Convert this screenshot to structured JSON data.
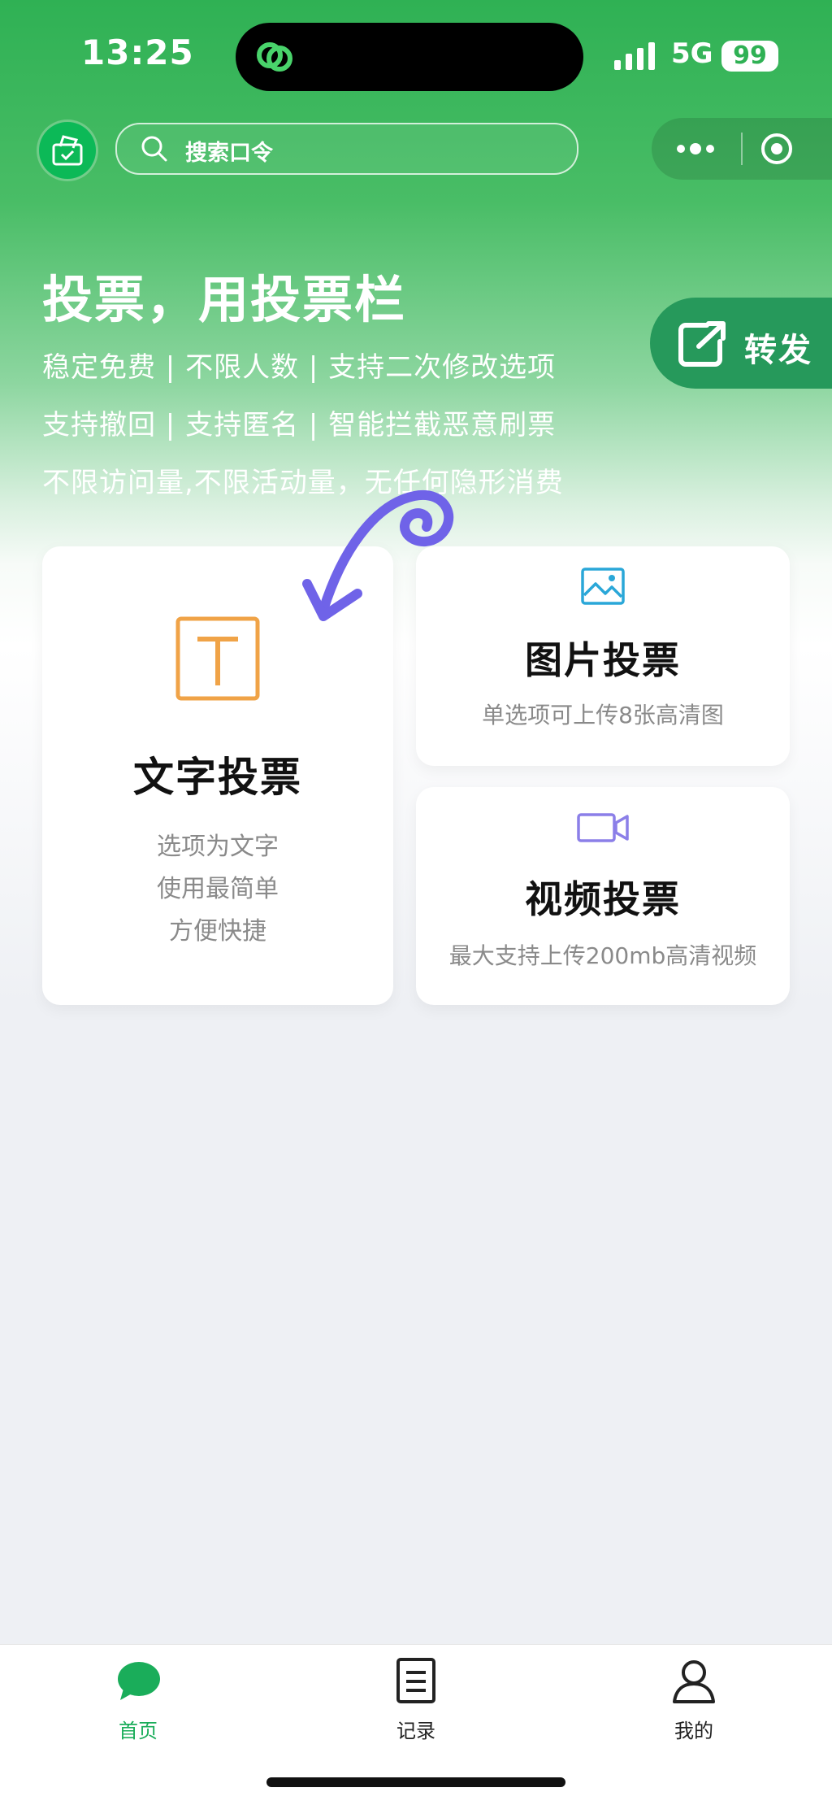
{
  "status_bar": {
    "time": "13:25",
    "network": "5G",
    "battery": "99"
  },
  "top_bar": {
    "search_placeholder": "搜索口令"
  },
  "hero": {
    "title": "投票，用投票栏",
    "features": [
      "稳定免费 | 不限人数 | 支持二次修改选项",
      "支持撤回 | 支持匿名 | 智能拦截恶意刷票",
      "不限访问量,不限活动量，无任何隐形消费"
    ],
    "share_label": "转发"
  },
  "cards": {
    "text_vote": {
      "title": "文字投票",
      "lines": [
        "选项为文字",
        "使用最简单",
        "方便快捷"
      ],
      "icon_letter": "T",
      "icon_color": "#f0a347"
    },
    "image_vote": {
      "title": "图片投票",
      "desc": "单选项可上传8张高清图",
      "icon_color": "#2aa7d8"
    },
    "video_vote": {
      "title": "视频投票",
      "desc": "最大支持上传200mb高清视频",
      "icon_color": "#8b7fe8"
    }
  },
  "tabbar": {
    "tabs": [
      {
        "label": "首页",
        "icon": "chat-bubble-icon",
        "active": true
      },
      {
        "label": "记录",
        "icon": "document-icon",
        "active": false
      },
      {
        "label": "我的",
        "icon": "user-icon",
        "active": false
      }
    ]
  },
  "colors": {
    "brand_green": "#2fb154",
    "active_tab": "#1aad5a",
    "annotation_arrow": "#6f63e8"
  }
}
